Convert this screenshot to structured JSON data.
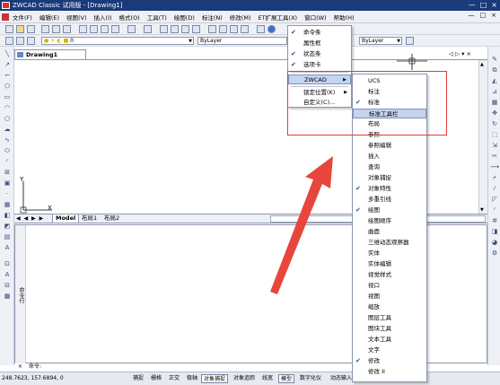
{
  "app": {
    "title": "ZWCAD Classic 试用版 - [Drawing1]"
  },
  "window_controls": [
    "—",
    "□",
    "×"
  ],
  "mdi_controls": [
    "—",
    "□",
    "×"
  ],
  "menubar": {
    "items": [
      "文件(F)",
      "编辑(E)",
      "视图(V)",
      "插入(I)",
      "格式(O)",
      "工具(T)",
      "绘图(D)",
      "标注(N)",
      "修改(M)",
      "ET扩展工具(X)",
      "窗口(W)",
      "帮助(H)"
    ]
  },
  "toolbar2": {
    "layer_value": "0",
    "linetype_value": "ByLayer",
    "lineweight_value": "ByLayer"
  },
  "document": {
    "tab_label": "Drawing1",
    "scroll_arrows": "◁ ▷ ▾ ×"
  },
  "layout_tabs": {
    "nav": "◀ ◀ ▶ ▶",
    "tabs": [
      "Model",
      "布局1",
      "布局2"
    ]
  },
  "command": {
    "side_label": "命令行",
    "prompt": "命令:",
    "close": "×"
  },
  "ucs": {
    "x_label": "X",
    "y_label": "Y"
  },
  "status": {
    "coords": "248.7623, 157.6894, 0",
    "buttons": [
      {
        "label": "捕捉",
        "on": false
      },
      {
        "label": "栅格",
        "on": false
      },
      {
        "label": "正交",
        "on": false
      },
      {
        "label": "极轴",
        "on": false
      },
      {
        "label": "对象捕捉",
        "on": true
      },
      {
        "label": "对象追踪",
        "on": false
      },
      {
        "label": "线宽",
        "on": false
      },
      {
        "label": "模型",
        "on": true
      },
      {
        "label": "数字化仪",
        "on": false
      },
      {
        "label": "动态输入",
        "on": false
      }
    ]
  },
  "context_menu": {
    "items": [
      {
        "label": "命令条",
        "checked": true,
        "submenu": false
      },
      {
        "label": "属性框",
        "checked": false,
        "submenu": false
      },
      {
        "label": "状态条",
        "checked": true,
        "submenu": false
      },
      {
        "label": "选项卡",
        "checked": true,
        "submenu": false
      },
      {
        "label": "ZWCAD",
        "checked": false,
        "submenu": true,
        "highlighted": true
      },
      {
        "label": "锁定位置(K)",
        "checked": false,
        "submenu": true
      },
      {
        "label": "自定义(C)...",
        "checked": false,
        "submenu": false
      }
    ]
  },
  "submenu": {
    "items": [
      {
        "label": "UCS",
        "checked": false
      },
      {
        "label": "标注",
        "checked": false
      },
      {
        "label": "标准",
        "checked": true
      },
      {
        "label": "标准工具栏",
        "checked": false,
        "highlighted": true
      },
      {
        "label": "布局",
        "checked": false
      },
      {
        "label": "参照",
        "checked": false
      },
      {
        "label": "参照编辑",
        "checked": false
      },
      {
        "label": "插入",
        "checked": false
      },
      {
        "label": "查询",
        "checked": false
      },
      {
        "label": "对象捕捉",
        "checked": false
      },
      {
        "label": "对象特性",
        "checked": true
      },
      {
        "label": "多重引线",
        "checked": false
      },
      {
        "label": "绘图",
        "checked": true
      },
      {
        "label": "绘图顺序",
        "checked": false
      },
      {
        "label": "曲面",
        "checked": false
      },
      {
        "label": "三维动态观察器",
        "checked": false
      },
      {
        "label": "实体",
        "checked": false
      },
      {
        "label": "实体编辑",
        "checked": false
      },
      {
        "label": "视觉样式",
        "checked": false
      },
      {
        "label": "视口",
        "checked": false
      },
      {
        "label": "视图",
        "checked": false
      },
      {
        "label": "缩放",
        "checked": false
      },
      {
        "label": "图层工具",
        "checked": false
      },
      {
        "label": "图块工具",
        "checked": false
      },
      {
        "label": "文本工具",
        "checked": false
      },
      {
        "label": "文字",
        "checked": false
      },
      {
        "label": "修改",
        "checked": true
      },
      {
        "label": "修改 II",
        "checked": false
      }
    ]
  },
  "colors": {
    "highlight": "#c6d4ee",
    "annotation_red": "#e23a3a",
    "titlebar": "#1a3a7a"
  }
}
